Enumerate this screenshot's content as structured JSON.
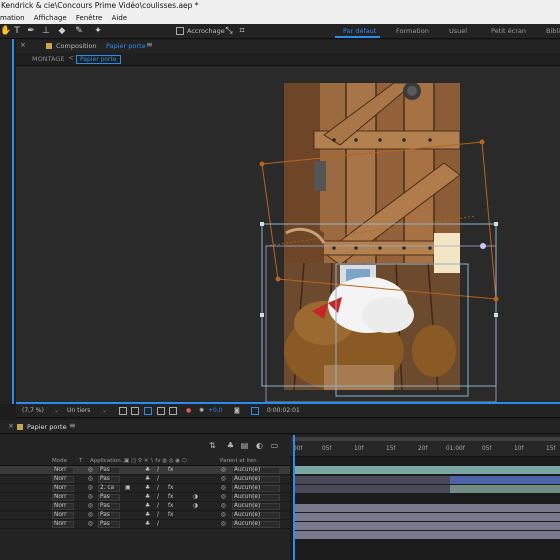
{
  "window": {
    "title": "Kendrick & cie\\Concours Prime Vidéo\\coulisses.aep *"
  },
  "menubar": {
    "items": [
      "mation",
      "Affichage",
      "Fenêtre",
      "Aide"
    ]
  },
  "toolbar": {
    "snap_label": "Accrochage",
    "workspaces": [
      {
        "label": "Par défaut",
        "active": true
      },
      {
        "label": "Formation",
        "active": false
      },
      {
        "label": "Usuel",
        "active": false
      },
      {
        "label": "Petit écran",
        "active": false
      },
      {
        "label": "Bibliot",
        "active": false
      }
    ],
    "accent": "#2d8ceb"
  },
  "composition": {
    "header_label": "Composition",
    "name": "Papier porte",
    "menu_glyph": "≡"
  },
  "montage": {
    "label": "MONTAGE",
    "arrow": "<",
    "crumb": "Papier porte"
  },
  "viewer_footer": {
    "zoom": "(7,7 %)",
    "resolution": "Un tiers",
    "exposure": "+0,0",
    "timecode": "0:00:02:01"
  },
  "timeline": {
    "tab_name": "Papier porte",
    "menu_glyph": "≡",
    "columns": {
      "mode": "Mode",
      "t": "T",
      "application": "Application...",
      "parent": "Parent et lien"
    },
    "layers": [
      {
        "mode": "Norr",
        "app": "Pas",
        "parent": "Aucun(e)",
        "selected": true
      },
      {
        "mode": "Norr",
        "app": "Pas",
        "parent": "Aucun(e)",
        "selected": false
      },
      {
        "mode": "Norr",
        "app": "2. ca",
        "parent": "Aucun(e)",
        "selected": false
      },
      {
        "mode": "Norr",
        "app": "Pas",
        "parent": "Aucun(e)",
        "selected": false
      },
      {
        "mode": "Norr",
        "app": "Pas",
        "parent": "Aucun(e)",
        "selected": false
      },
      {
        "mode": "Norr",
        "app": "Pas",
        "parent": "Aucun(e)",
        "selected": false
      },
      {
        "mode": "Norr",
        "app": "Pas",
        "parent": "Aucun(e)",
        "selected": false
      }
    ],
    "ruler_ticks": [
      "00f",
      "05f",
      "10f",
      "15f",
      "20f",
      "01:00f",
      "05f",
      "10f",
      "15f"
    ]
  }
}
